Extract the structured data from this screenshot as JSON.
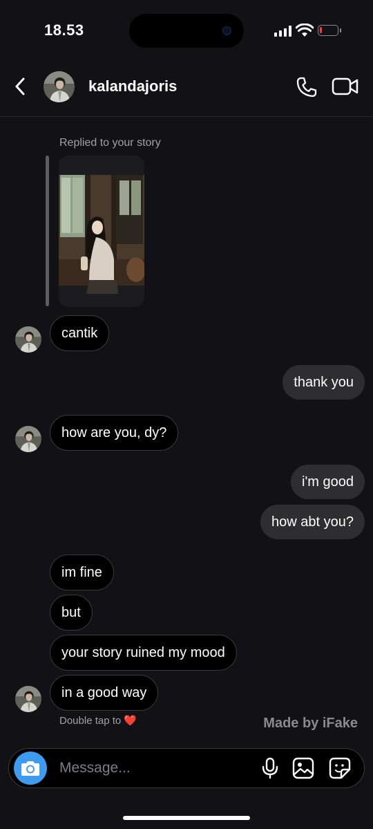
{
  "status_bar": {
    "time": "18.53",
    "battery_level": 0.15
  },
  "header": {
    "username": "kalandajoris",
    "back": "chevron-left-icon",
    "call": "phone-icon",
    "video": "video-camera-icon"
  },
  "story_reply": {
    "label": "Replied to your story"
  },
  "messages": [
    {
      "from": "them",
      "text": "cantik"
    },
    {
      "from": "me",
      "text": "thank you"
    },
    {
      "from": "them",
      "text": "how are you, dy?"
    },
    {
      "from": "me",
      "text": "i'm good"
    },
    {
      "from": "me",
      "text": "how abt you?"
    },
    {
      "from": "them",
      "text": "im fine"
    },
    {
      "from": "them",
      "text": "but"
    },
    {
      "from": "them",
      "text": "your story ruined my mood"
    },
    {
      "from": "them",
      "text": "in a good way"
    }
  ],
  "double_tap": {
    "label": "Double tap to",
    "emoji": "❤️"
  },
  "watermark": "Made by iFake",
  "composer": {
    "placeholder": "Message...",
    "icons": [
      "camera-icon",
      "microphone-icon",
      "gallery-icon",
      "sticker-icon"
    ]
  },
  "colors": {
    "background": "#121216",
    "outgoing_bubble": "#2e2e31",
    "incoming_bubble": "#000000",
    "camera_button": "#3d9bf0"
  }
}
